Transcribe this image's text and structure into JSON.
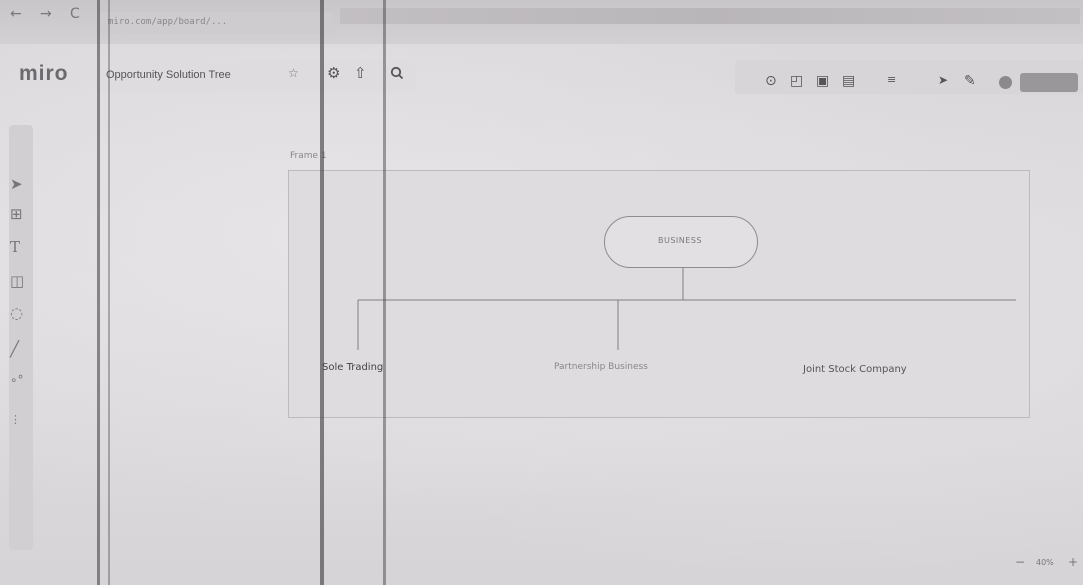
{
  "browser": {
    "nav": [
      "←",
      "→",
      "C"
    ],
    "url": "miro.com/app/board/..."
  },
  "header": {
    "logo": "miro",
    "board_title": "Opportunity Solution Tree",
    "star_icon": "star-icon",
    "settings_icon": "gear-icon",
    "upload_icon": "upload-icon",
    "search_icon": "search-icon"
  },
  "right_toolbar": {
    "icons": [
      "timer-icon",
      "present-icon",
      "comment-icon",
      "notes-icon",
      "more-icon",
      "cursor-icon",
      "reactions-icon",
      "avatar"
    ]
  },
  "left_toolbar": {
    "tools": [
      "select-icon",
      "templates-icon",
      "text-icon",
      "sticky-note-icon",
      "shapes-icon",
      "pen-icon",
      "connector-icon",
      "more-tools-icon"
    ]
  },
  "frame": {
    "label": "Frame 1",
    "root": "BUSINESS",
    "children": [
      "Sole Trading",
      "Partnership Business",
      "Joint Stock Company"
    ]
  },
  "zoom": {
    "minus": "−",
    "level": "40%",
    "plus": "+"
  }
}
